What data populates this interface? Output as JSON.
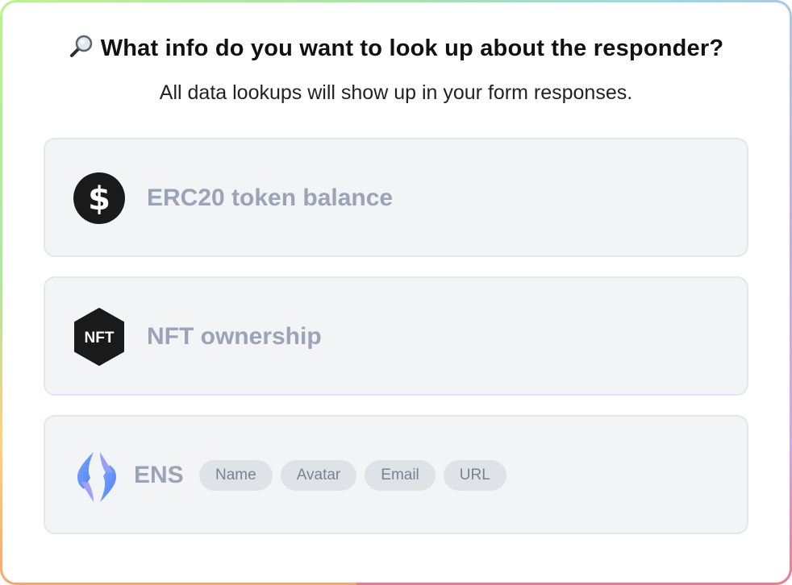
{
  "header": {
    "title": "What info do you want to look up about the responder?",
    "subtitle": "All data lookups will show up in your form responses.",
    "title_icon": "magnifying-glass-icon"
  },
  "options": [
    {
      "label": "ERC20 token balance",
      "icon": "dollar-coin-icon"
    },
    {
      "label": "NFT ownership",
      "icon": "nft-hexagon-icon",
      "icon_text": "NFT"
    },
    {
      "label": "ENS",
      "icon": "ens-logo-icon",
      "chips": [
        "Name",
        "Avatar",
        "Email",
        "URL"
      ]
    }
  ],
  "colors": {
    "card_background": "#f3f4f6",
    "card_border": "#e4e6ea",
    "label_text": "#9aa3b7",
    "chip_background": "#dfe2e7",
    "chip_text": "#7b8391",
    "icon_dark": "#1a1a1a"
  }
}
